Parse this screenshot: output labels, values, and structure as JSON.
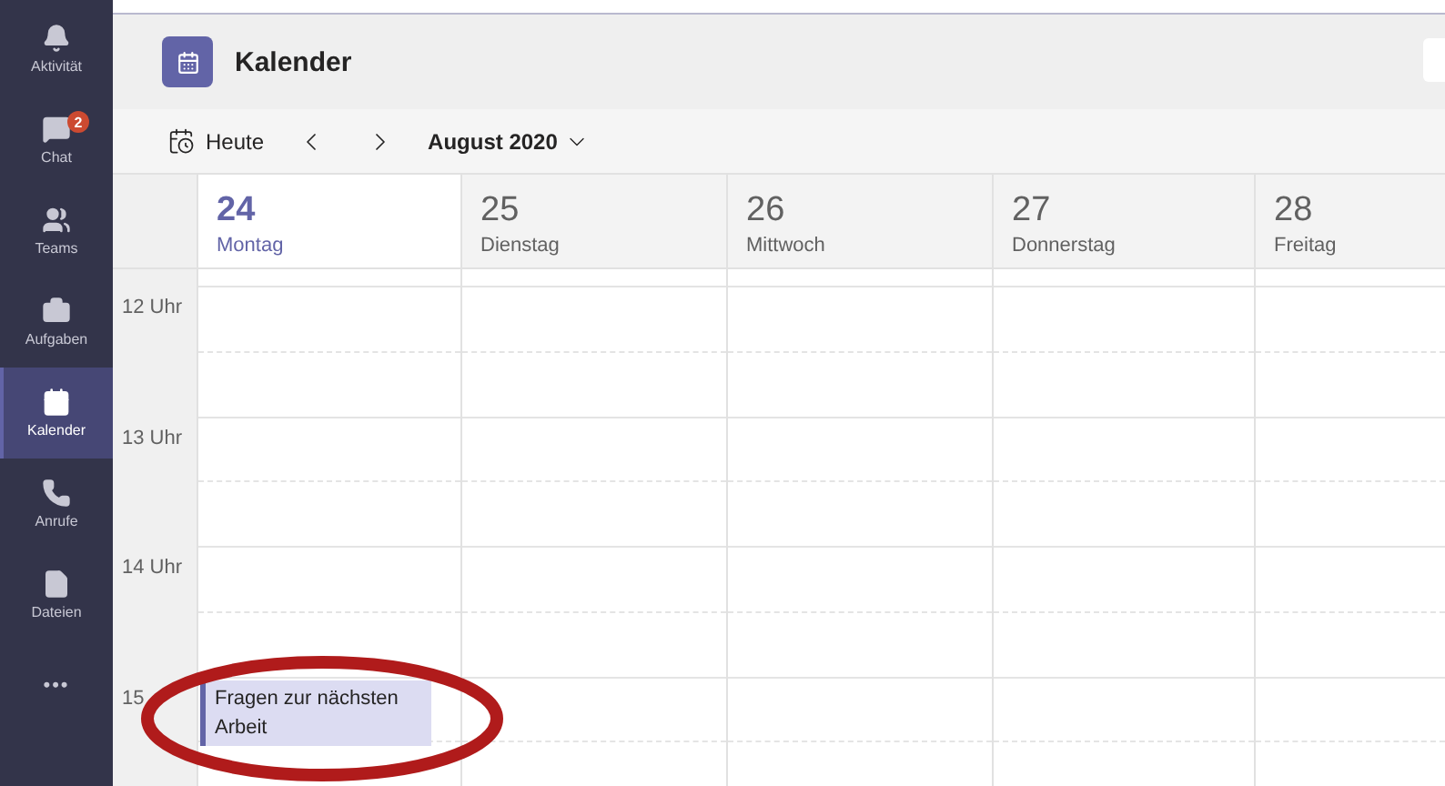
{
  "sidebar": {
    "items": [
      {
        "label": "Aktivität",
        "selected": false
      },
      {
        "label": "Chat",
        "selected": false,
        "badge": "2"
      },
      {
        "label": "Teams",
        "selected": false
      },
      {
        "label": "Aufgaben",
        "selected": false
      },
      {
        "label": "Kalender",
        "selected": true
      },
      {
        "label": "Anrufe",
        "selected": false
      },
      {
        "label": "Dateien",
        "selected": false
      }
    ],
    "more": "•••"
  },
  "header": {
    "title": "Kalender"
  },
  "toolbar": {
    "today": "Heute",
    "month": "August 2020"
  },
  "hours": [
    "12 Uhr",
    "13 Uhr",
    "14 Uhr",
    "15"
  ],
  "days": [
    {
      "number": "24",
      "weekday": "Montag",
      "selected": true,
      "events": [
        {
          "title": "Fragen zur nächsten Arbeit"
        }
      ]
    },
    {
      "number": "25",
      "weekday": "Dienstag",
      "selected": false
    },
    {
      "number": "26",
      "weekday": "Mittwoch",
      "selected": false
    },
    {
      "number": "27",
      "weekday": "Donnerstag",
      "selected": false
    },
    {
      "number": "28",
      "weekday": "Freitag",
      "selected": false
    }
  ]
}
